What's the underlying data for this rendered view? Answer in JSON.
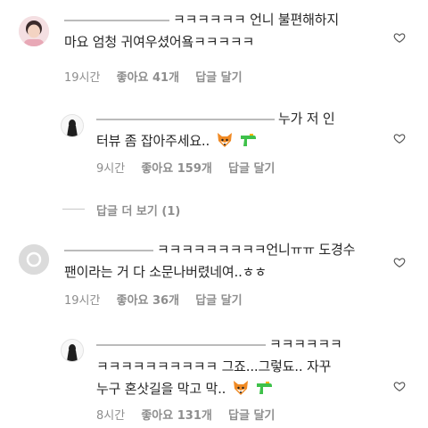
{
  "comments": [
    {
      "text_line1": "ㅋㅋㅋㅋㅋㅋ 언니 불편해하지",
      "text_line2": "마요 엄청 귀여우셨어욬ㅋㅋㅋㅋㅋ",
      "time": "19시간",
      "likes": "좋아요 41개",
      "reply": "답글 달기"
    },
    {
      "text_line1": "누가 저 인",
      "text_line2": "터뷰 좀 잡아주세요..",
      "time": "9시간",
      "likes": "좋아요 159개",
      "reply": "답글 달기"
    },
    {
      "text_line1": "ㅋㅋㅋㅋㅋㅋㅋㅋㅋ언니ㅠㅠ 도경수",
      "text_line2": "팬이라는 거 다 소문나버렸네여..ㅎㅎ",
      "time": "19시간",
      "likes": "좋아요 36개",
      "reply": "답글 달기"
    },
    {
      "text_line1": "ㅋㅋㅋㅋㅋㅋ",
      "text_line2": "ㅋㅋㅋㅋㅋㅋㅋㅋㅋㅋ 그죠...그렇됴.. 자꾸",
      "text_line3": "누구 혼삿길을 막고 막..",
      "time": "8시간",
      "likes": "좋아요 131개",
      "reply": "답글 달기"
    }
  ],
  "view_more": "답글 더 보기 (1)",
  "icons": {
    "heart": "heart-outline-icon",
    "fox": "fox-emoji-icon",
    "water_gun": "water-pistol-emoji-icon"
  },
  "colors": {
    "text": "#262626",
    "meta": "#8e8e8e",
    "water_gun": "#3ec14a",
    "fox": "#f08a24"
  }
}
